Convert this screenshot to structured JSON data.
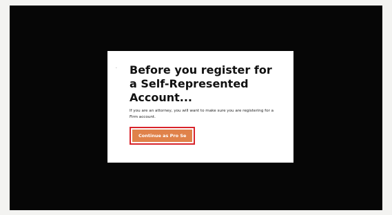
{
  "dialog": {
    "close_glyph": "·",
    "title": "Before you register for a Self-Represented Account...",
    "body": "If you are an attorney, you will want to make sure you are registering for a Firm account.",
    "button_label": "Continue as Pro Se"
  },
  "colors": {
    "backdrop": "#060606",
    "button": "#e0824a",
    "highlight_border": "#d8232a"
  }
}
